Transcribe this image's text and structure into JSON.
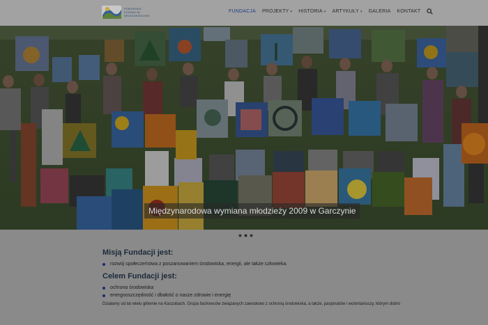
{
  "header": {
    "logo": {
      "line1": "Pomorska",
      "line2": "Fundacja",
      "line3": "Środowiskowa",
      "icon": "wave-logo-icon"
    },
    "nav": [
      {
        "label": "FUNDACJA",
        "active": true,
        "dropdown": false
      },
      {
        "label": "PROJEKTY",
        "active": false,
        "dropdown": true
      },
      {
        "label": "HISTORIA",
        "active": false,
        "dropdown": true
      },
      {
        "label": "ARTYKUŁY",
        "active": false,
        "dropdown": true
      },
      {
        "label": "GALERIA",
        "active": false,
        "dropdown": false
      },
      {
        "label": "KONTAKT",
        "active": false,
        "dropdown": false
      }
    ],
    "search_icon": "search-icon",
    "accent": "#1f3f83"
  },
  "slider": {
    "caption": "Międzynarodowa wymiana młodzieży 2009 w Garczynie",
    "slides": 3,
    "active_slide": 2
  },
  "content": {
    "mission_heading": "Misją Fundacji jest:",
    "mission_items": [
      "rozwój społeczeństwa z poszanowaniem środowiska, energii, ale także człowieka."
    ],
    "goal_heading": "Celem Fundacji jest:",
    "goal_items": [
      "ochrona środowiska",
      "energooszczędność i dbałość o nasze zdrowie i energię"
    ],
    "paragraph": "Działamy od lat wielu głównie na Kaszubach. Grupa fachowców związanych zawodowo z ochroną środowiska, a także, pasjonatów i wolontariuszy, którym dobro"
  }
}
